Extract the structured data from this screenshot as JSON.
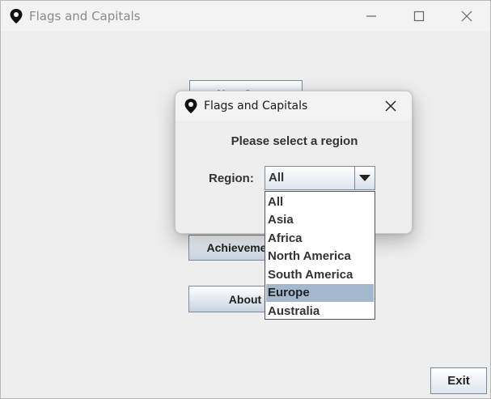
{
  "window": {
    "title": "Flags and Capitals",
    "minimize_icon": "minimize-icon",
    "maximize_icon": "maximize-icon",
    "close_icon": "close-icon",
    "app_icon": "location-pin-icon"
  },
  "main": {
    "buttons": [
      {
        "label": "New Game"
      },
      {
        "label": "Achievements"
      },
      {
        "label": "About"
      }
    ],
    "exit_label": "Exit"
  },
  "dialog": {
    "title": "Flags and Capitals",
    "prompt": "Please select a region",
    "region_label": "Region:",
    "selected_value": "All",
    "options": [
      "All",
      "Asia",
      "Africa",
      "North America",
      "South America",
      "Europe",
      "Australia"
    ],
    "highlighted_option": "Europe"
  },
  "colors": {
    "accent_highlight": "#a3b8cc",
    "button_border": "#7a8a9c",
    "background": "#eeeeee"
  }
}
